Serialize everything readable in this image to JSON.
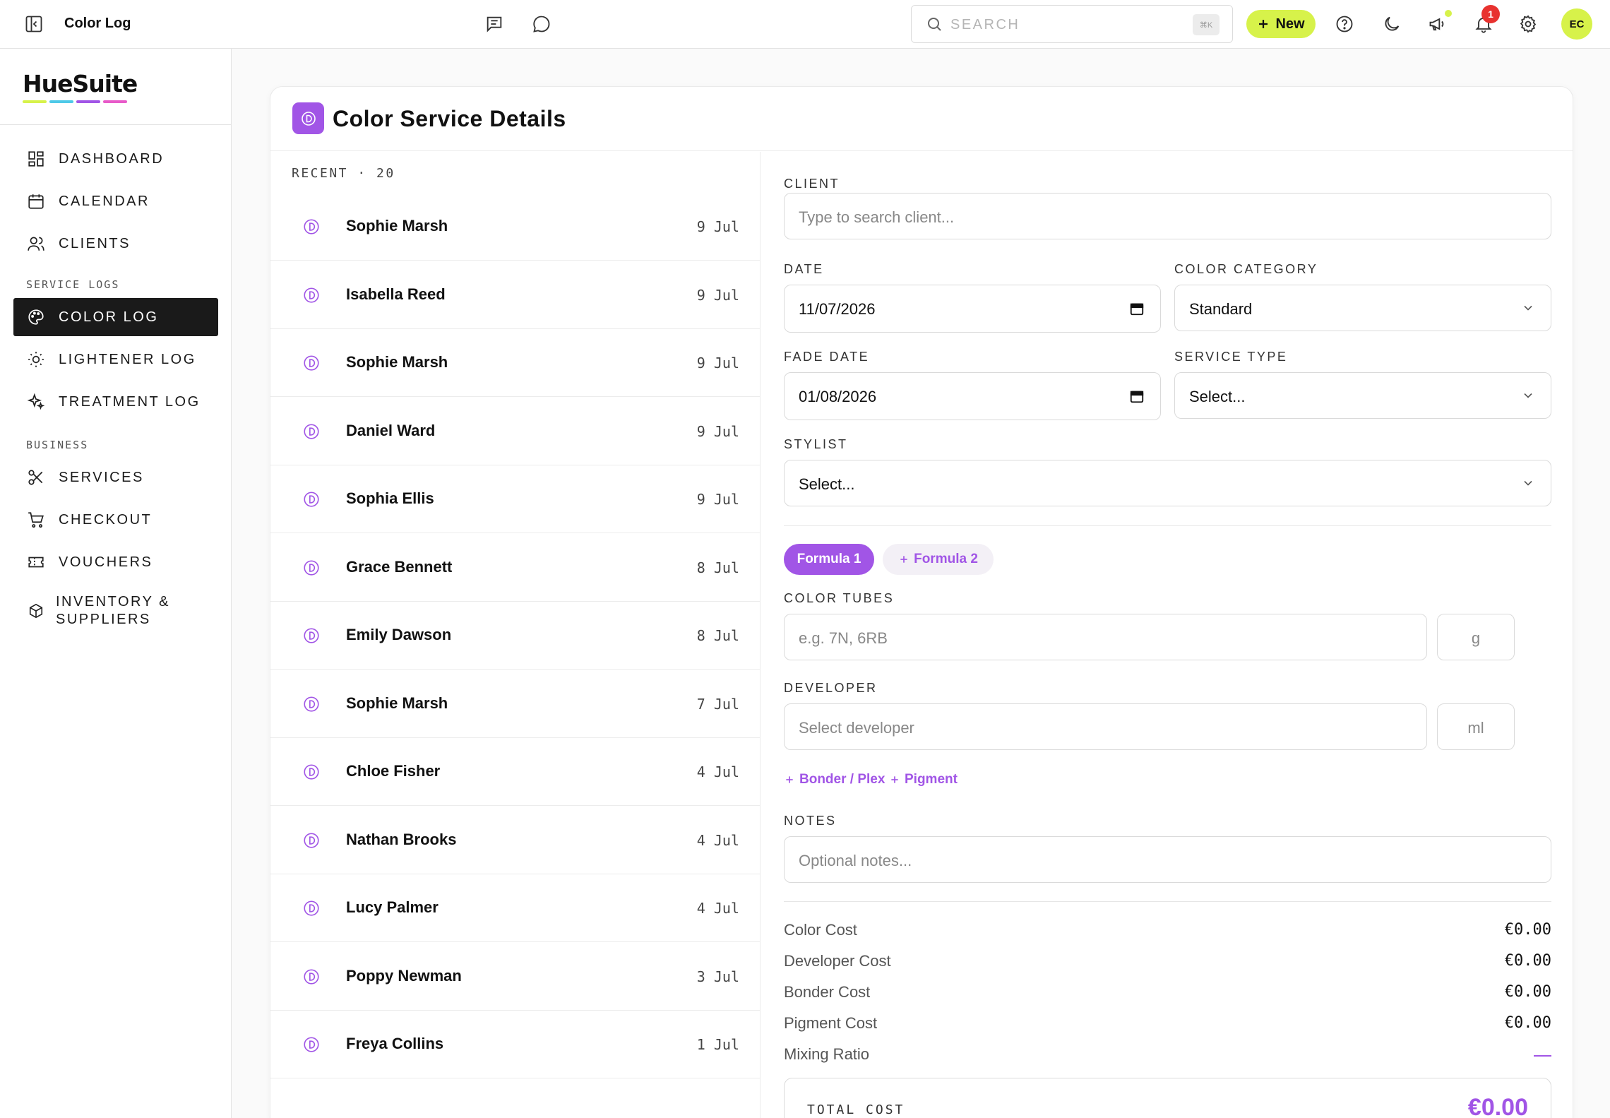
{
  "topbar": {
    "title": "Color Log",
    "search_placeholder": "SEARCH",
    "search_shortcut": "⌘K",
    "new_label": "New",
    "notification_count": "1",
    "avatar_initials": "EC"
  },
  "sidebar": {
    "brand": "HueSuite",
    "brand_colors": [
      "#d7f24a",
      "#4ec9e8",
      "#a155e6",
      "#e85ac9"
    ],
    "items_main": [
      {
        "label": "DASHBOARD",
        "icon": "dashboard-icon"
      },
      {
        "label": "CALENDAR",
        "icon": "calendar-icon"
      },
      {
        "label": "CLIENTS",
        "icon": "users-icon"
      }
    ],
    "section_service_logs": "SERVICE LOGS",
    "items_logs": [
      {
        "label": "COLOR LOG",
        "icon": "palette-icon",
        "active": true
      },
      {
        "label": "LIGHTENER LOG",
        "icon": "sun-icon"
      },
      {
        "label": "TREATMENT LOG",
        "icon": "sparkles-icon"
      }
    ],
    "section_business": "BUSINESS",
    "items_business": [
      {
        "label": "SERVICES",
        "icon": "scissors-icon"
      },
      {
        "label": "CHECKOUT",
        "icon": "cart-icon"
      },
      {
        "label": "VOUCHERS",
        "icon": "ticket-icon"
      },
      {
        "label_line1": "INVENTORY &",
        "label_line2": "SUPPLIERS",
        "icon": "box-icon"
      }
    ]
  },
  "main": {
    "title": "Color Service Details",
    "recent_label": "RECENT · 20",
    "recent": [
      {
        "name": "Sophie Marsh",
        "date": "9 Jul"
      },
      {
        "name": "Isabella Reed",
        "date": "9 Jul"
      },
      {
        "name": "Sophie Marsh",
        "date": "9 Jul"
      },
      {
        "name": "Daniel Ward",
        "date": "9 Jul"
      },
      {
        "name": "Sophia Ellis",
        "date": "9 Jul"
      },
      {
        "name": "Grace Bennett",
        "date": "8 Jul"
      },
      {
        "name": "Emily Dawson",
        "date": "8 Jul"
      },
      {
        "name": "Sophie Marsh",
        "date": "7 Jul"
      },
      {
        "name": "Chloe Fisher",
        "date": "4 Jul"
      },
      {
        "name": "Nathan Brooks",
        "date": "4 Jul"
      },
      {
        "name": "Lucy Palmer",
        "date": "4 Jul"
      },
      {
        "name": "Poppy Newman",
        "date": "3 Jul"
      },
      {
        "name": "Freya Collins",
        "date": "1 Jul"
      }
    ],
    "form": {
      "client_label": "CLIENT",
      "client_placeholder": "Type to search client...",
      "date_label": "DATE",
      "date_value": "11/07/2026",
      "category_label": "COLOR CATEGORY",
      "category_value": "Standard",
      "fade_label": "FADE DATE",
      "fade_value": "01/08/2026",
      "service_type_label": "SERVICE TYPE",
      "service_type_value": "Select...",
      "stylist_label": "STYLIST",
      "stylist_value": "Select...",
      "formula1": "Formula 1",
      "formula2": "Formula 2",
      "tubes_label": "COLOR TUBES",
      "tubes_placeholder": "e.g. 7N, 6RB",
      "tubes_unit": "g",
      "developer_label": "DEVELOPER",
      "developer_placeholder": "Select developer",
      "developer_unit": "ml",
      "add_bonder": "Bonder / Plex",
      "add_pigment": "Pigment",
      "notes_label": "NOTES",
      "notes_placeholder": "Optional notes..."
    },
    "costs": [
      {
        "label": "Color Cost",
        "value": "€0.00"
      },
      {
        "label": "Developer Cost",
        "value": "€0.00"
      },
      {
        "label": "Bonder Cost",
        "value": "€0.00"
      },
      {
        "label": "Pigment Cost",
        "value": "€0.00"
      }
    ],
    "mixing_ratio_label": "Mixing Ratio",
    "total_label": "TOTAL COST",
    "total_value": "€0.00",
    "accent": "#a155e6"
  }
}
